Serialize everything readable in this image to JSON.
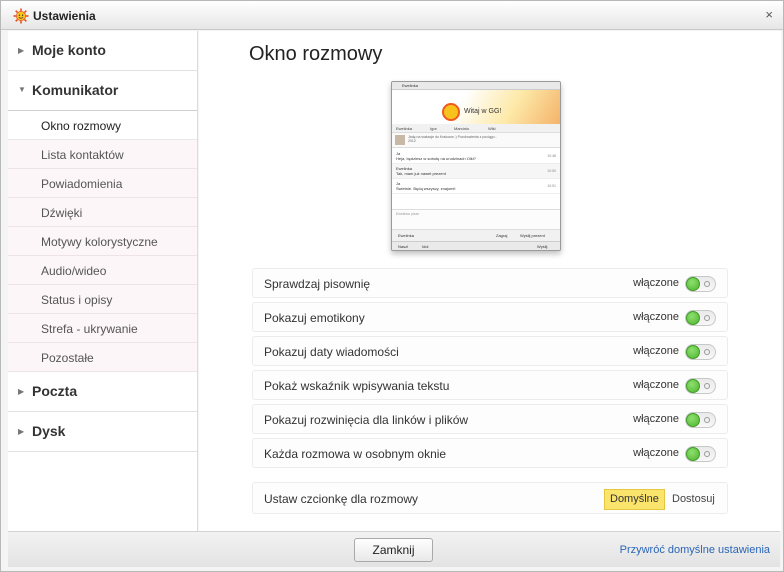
{
  "window": {
    "title": "Ustawienia",
    "icon": "gg-sun-icon",
    "close_glyph": "×"
  },
  "sidebar": {
    "sections": [
      {
        "label": "Moje konto",
        "expanded": false
      },
      {
        "label": "Komunikator",
        "expanded": true
      },
      {
        "label": "Poczta",
        "expanded": false
      },
      {
        "label": "Dysk",
        "expanded": false
      }
    ],
    "komunikator_items": [
      {
        "label": "Okno rozmowy",
        "active": true
      },
      {
        "label": "Lista kontaktów",
        "active": false
      },
      {
        "label": "Powiadomienia",
        "active": false
      },
      {
        "label": "Dźwięki",
        "active": false
      },
      {
        "label": "Motywy kolorystyczne",
        "active": false
      },
      {
        "label": "Audio/wideo",
        "active": false
      },
      {
        "label": "Status i opisy",
        "active": false
      },
      {
        "label": "Strefa - ukrywanie",
        "active": false
      },
      {
        "label": "Pozostałe",
        "active": false
      }
    ]
  },
  "main": {
    "heading": "Okno rozmowy",
    "preview": {
      "window_title": "Ewelinka",
      "banner_text": "Witaj w GG!",
      "tabs": [
        "Ewelinka",
        "Igor",
        "Marcinio",
        "Wiki"
      ],
      "contact_desc": "Jadę na wakacje do Krakowa :) Pozdrowienia z pociągu - 2012",
      "messages": [
        {
          "from": "Ja",
          "text": "Heja, będziesz w sobotę na urodzinach Olki?",
          "time": "10:48"
        },
        {
          "from": "Ewelinka",
          "text": "Tak, mam już nawet prezent",
          "time": "10:50"
        },
        {
          "from": "Ja",
          "text": "Świetnie. Będą wszyscy, znajomi!",
          "time": "10:51"
        }
      ],
      "input_placeholder": "Ewelinka pisze",
      "toolbar_left": "Ewelinka",
      "toolbar_btn1": "Zagraj",
      "toolbar_btn2": "Wyślij prezent",
      "footer_left": "Naszl",
      "footer_mid": "Idol",
      "footer_right": "Wyślij"
    },
    "options": [
      {
        "label": "Sprawdzaj pisownię",
        "state": "włączone",
        "enabled": true
      },
      {
        "label": "Pokazuj emotikony",
        "state": "włączone",
        "enabled": true
      },
      {
        "label": "Pokazuj daty wiadomości",
        "state": "włączone",
        "enabled": true
      },
      {
        "label": "Pokaż wskaźnik wpisywania tekstu",
        "state": "włączone",
        "enabled": true
      },
      {
        "label": "Pokazuj rozwinięcia dla linków i plików",
        "state": "włączone",
        "enabled": true
      },
      {
        "label": "Każda rozmowa w osobnym oknie",
        "state": "włączone",
        "enabled": true
      }
    ],
    "font_option": {
      "label": "Ustaw czcionkę dla rozmowy",
      "default_label": "Domyślne",
      "custom_label": "Dostosuj",
      "selected": "Domyślne"
    }
  },
  "footer": {
    "close_label": "Zamknij",
    "restore_label": "Przywróć domyślne ustawienia"
  },
  "colors": {
    "toggle_on": "#4fb52e",
    "selected_segment": "#fbe46c",
    "link": "#2a66b8",
    "sidebar_sub_bg": "#fcf6f9"
  }
}
